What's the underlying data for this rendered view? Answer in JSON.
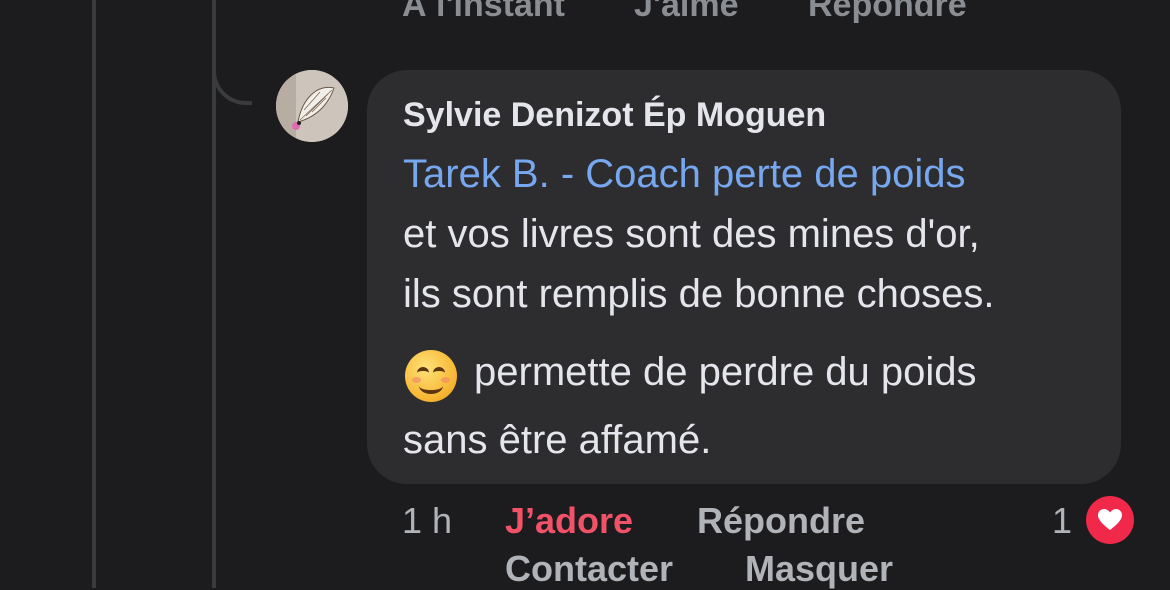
{
  "previous_comment": {
    "time": "À l'instant",
    "like_label": "J'aime",
    "reply_label": "Répondre"
  },
  "comment": {
    "author": "Sylvie Denizot Ép Moguen",
    "mention": "Tarek B. - Coach perte de poids",
    "text_lines": [
      "et vos livres sont des mines d'or,",
      "ils sont remplis de bonne choses."
    ],
    "emoji_icon": "smiling-face-emoji",
    "text_after_emoji": "permette de perdre du poids",
    "text_last_line": "sans être affamé.",
    "time": "1 h",
    "reaction_label": "J’adore",
    "reply_label": "Répondre",
    "contact_label": "Contacter",
    "hide_label": "Masquer",
    "reaction_count": "1",
    "reaction_icon": "heart-icon"
  },
  "colors": {
    "background": "#1c1c1e",
    "bubble": "#2d2d30",
    "mention": "#76a7ef",
    "love": "#f25268",
    "heart": "#f0284a"
  }
}
